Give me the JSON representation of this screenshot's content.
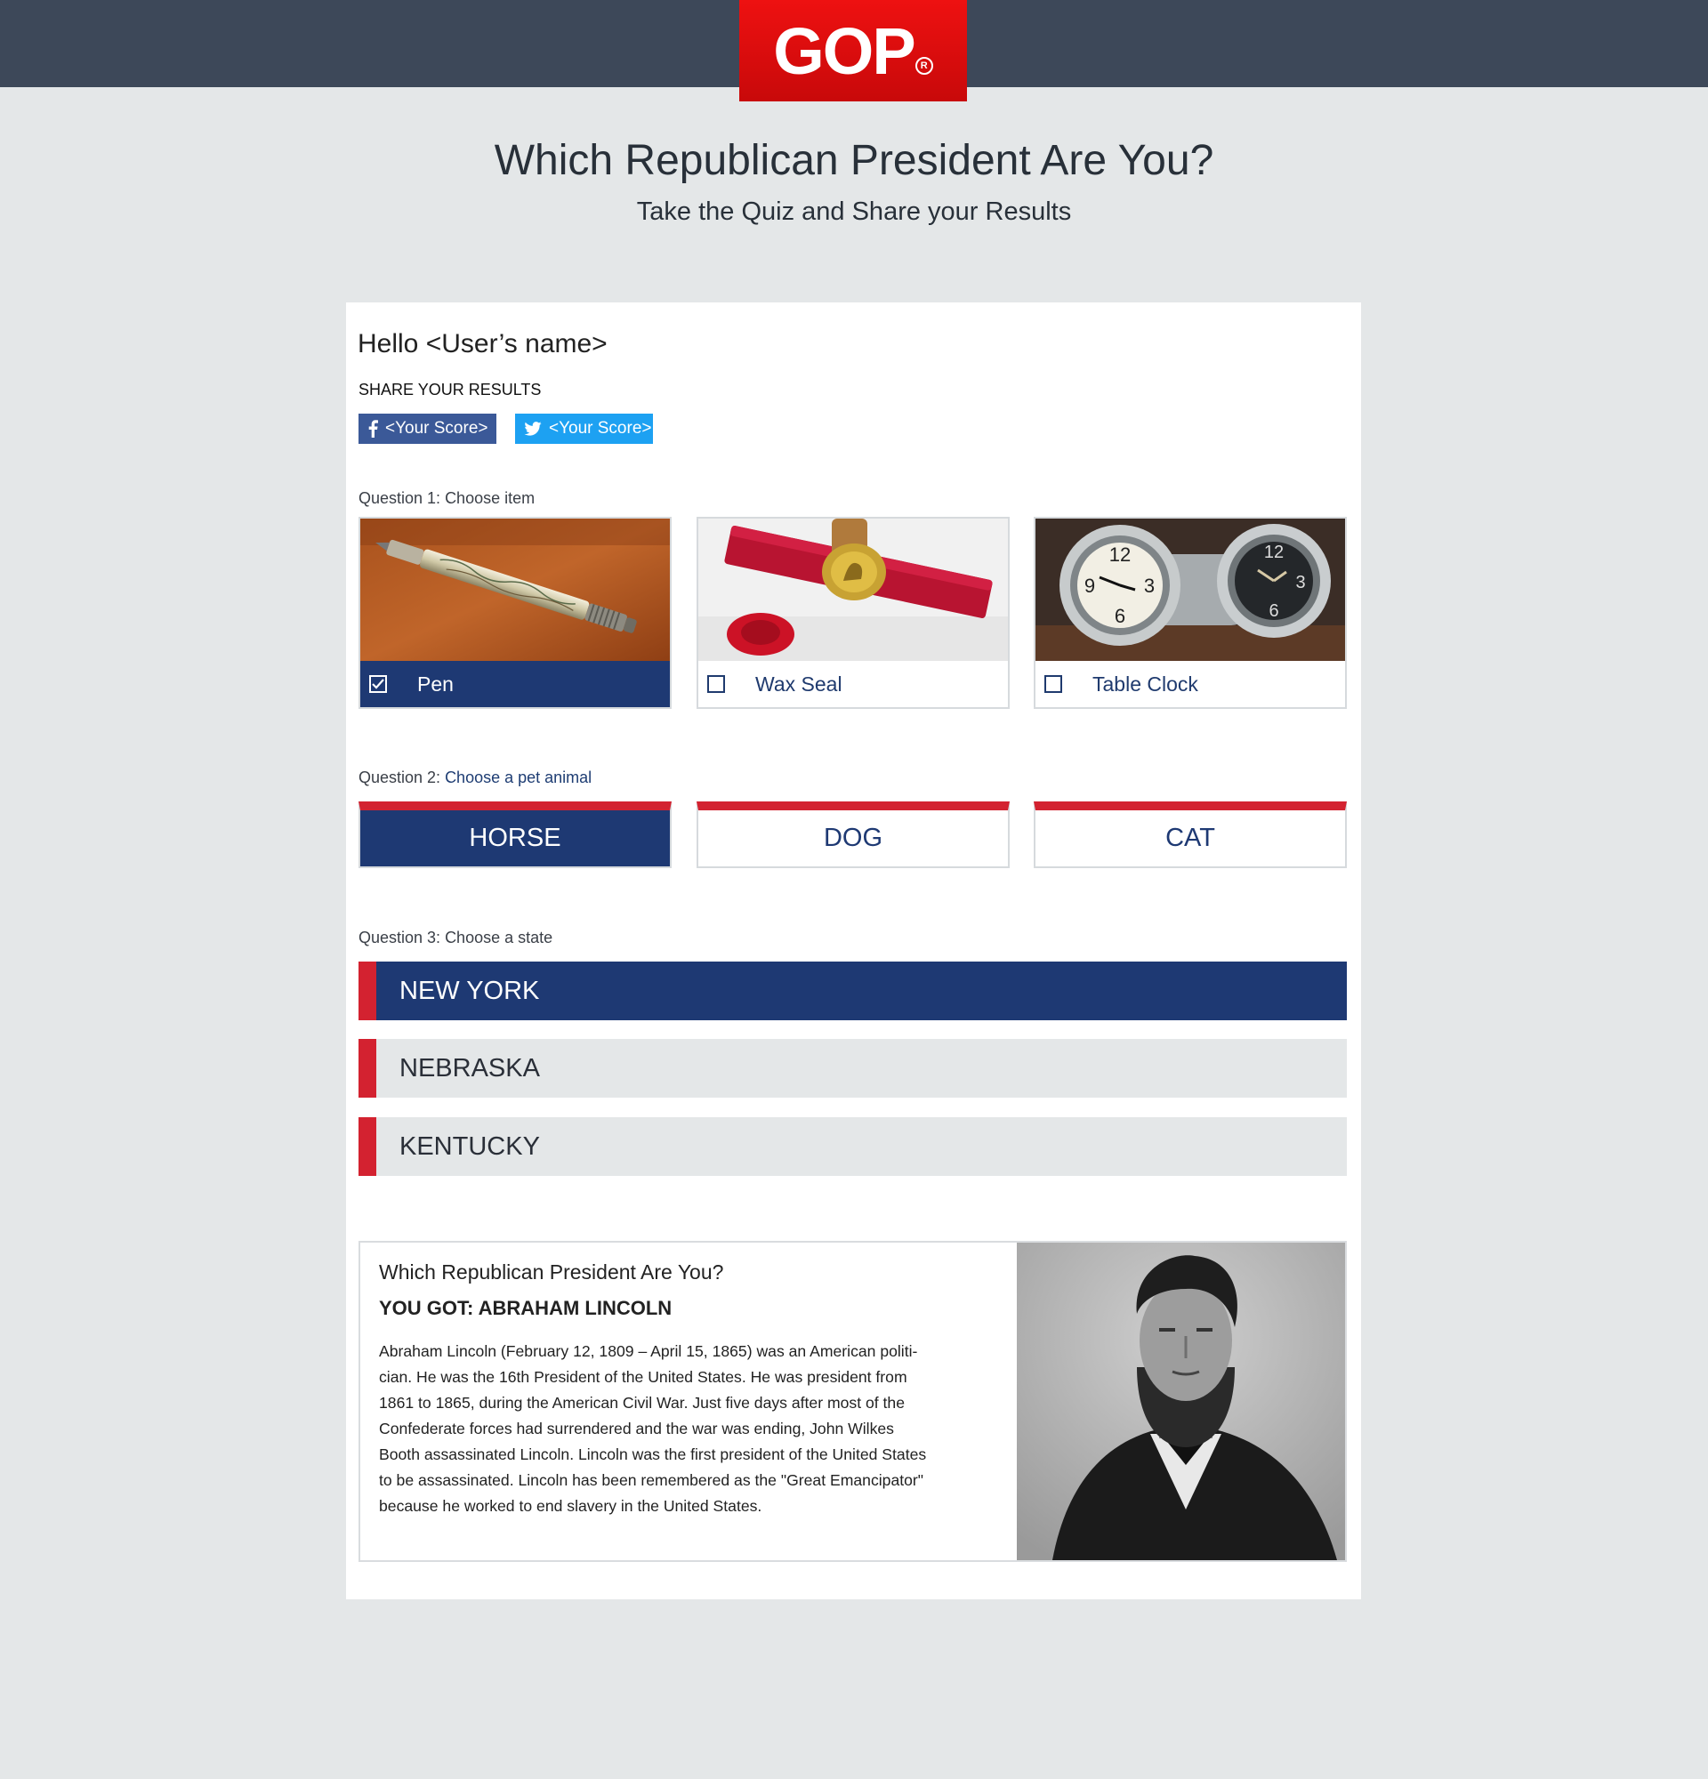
{
  "brand": {
    "logo_text": "GOP",
    "logo_mark": "R",
    "topbar_color": "#3d4859",
    "logo_color": "#e11b22"
  },
  "header": {
    "title": "Which Republican President Are You?",
    "subtitle": "Take the Quiz and Share your Results"
  },
  "greeting": "Hello <User’s name>",
  "share": {
    "label": "SHARE YOUR RESULTS",
    "facebook_label": "<Your Score>",
    "twitter_label": "<Your Score>",
    "facebook_icon": "facebook-icon",
    "twitter_icon": "twitter-icon",
    "facebook_color": "#3b5998",
    "twitter_color": "#1da1f2"
  },
  "question1": {
    "prefix": "Question 1: ",
    "text": "Choose item",
    "options": [
      {
        "label": "Pen",
        "checked": true
      },
      {
        "label": "Wax Seal",
        "checked": false
      },
      {
        "label": "Table Clock",
        "checked": false
      }
    ]
  },
  "question2": {
    "prefix": "Question 2: ",
    "text": "Choose a pet animal",
    "options": [
      {
        "label": "HORSE",
        "selected": true
      },
      {
        "label": "DOG",
        "selected": false
      },
      {
        "label": "CAT",
        "selected": false
      }
    ]
  },
  "question3": {
    "prefix": "Question 3: ",
    "text": "Choose a state",
    "options": [
      {
        "label": "NEW YORK",
        "selected": true
      },
      {
        "label": "NEBRASKA",
        "selected": false
      },
      {
        "label": "KENTUCKY",
        "selected": false
      }
    ]
  },
  "result": {
    "quiz_title": "Which Republican President Are You?",
    "headline": "YOU GOT: ABRAHAM LINCOLN",
    "lines": [
      "Abraham Lincoln (February 12, 1809  – April 15, 1865) was an American politi-",
      "cian. He was the 16th President of the United States. He was president from",
      "1861 to 1865, during the American Civil War. Just five days after most of the",
      "Confederate forces had surrendered and the war was ending, John Wilkes",
      "Booth assassinated Lincoln. Lincoln was the first president of the United States",
      "to be assassinated. Lincoln has been remembered as the \"Great Emancipator\"",
      "because he worked to end slavery in the United States."
    ]
  },
  "colors": {
    "navy": "#1e3973",
    "red": "#d32230",
    "page_bg": "#e4e7e8"
  }
}
